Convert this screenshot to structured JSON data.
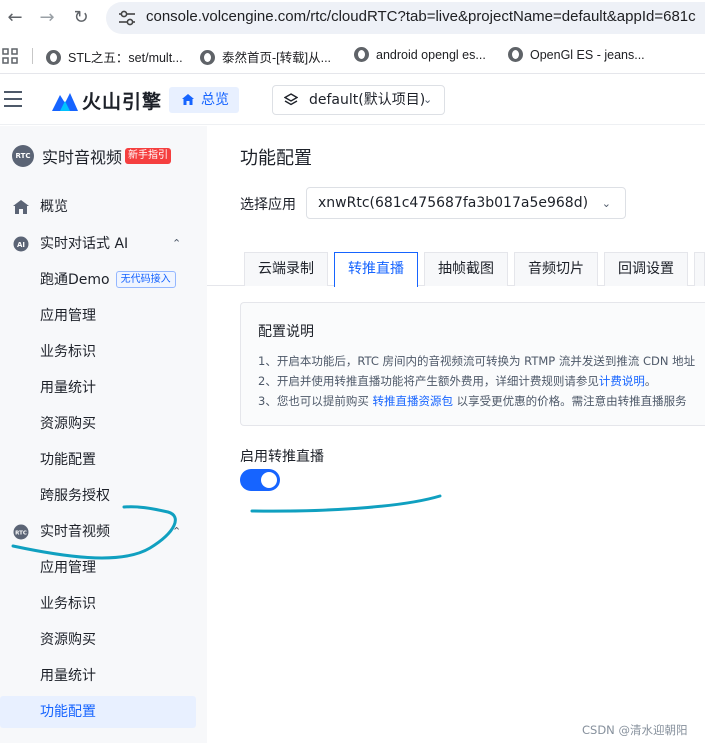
{
  "browser": {
    "url": "console.volcengine.com/rtc/cloudRTC?tab=live&projectName=default&appId=681c",
    "bookmarks": [
      {
        "label": "STL之五：set/mult..."
      },
      {
        "label": "泰然首页-[转载]从..."
      },
      {
        "label": "android opengl es..."
      },
      {
        "label": "OpenGl ES - jeans..."
      }
    ]
  },
  "header": {
    "logo_text": "火山引擎",
    "overview_label": "总览",
    "project_label": "default(默认项目)"
  },
  "sidebar": {
    "badge_text": "RTC",
    "title": "实时音视频",
    "new_tag": "新手指引",
    "items": [
      {
        "label": "概览",
        "icon": "house-icon"
      },
      {
        "label": "实时对话式 AI",
        "icon": "ai-icon",
        "chevron": "expanded"
      },
      {
        "label": "跑通Demo",
        "tag": "无代码接入"
      },
      {
        "label": "应用管理"
      },
      {
        "label": "业务标识"
      },
      {
        "label": "用量统计"
      },
      {
        "label": "资源购买"
      },
      {
        "label": "功能配置"
      },
      {
        "label": "跨服务授权"
      },
      {
        "label": "实时音视频",
        "icon": "rtc-icon",
        "chevron": "expanded"
      },
      {
        "label": "应用管理"
      },
      {
        "label": "业务标识"
      },
      {
        "label": "资源购买"
      },
      {
        "label": "用量统计"
      },
      {
        "label": "功能配置",
        "active": true
      }
    ]
  },
  "main": {
    "title": "功能配置",
    "app_label": "选择应用",
    "app_value": "xnwRtc(681c475687fa3b017a5e968d)",
    "tabs": [
      {
        "label": "云端录制"
      },
      {
        "label": "转推直播",
        "active": true
      },
      {
        "label": "抽帧截图"
      },
      {
        "label": "音频切片"
      },
      {
        "label": "回调设置"
      }
    ],
    "info": {
      "title": "配置说明",
      "line1": "1、开启本功能后，RTC 房间内的音视频流可转换为 RTMP 流并发送到推流 CDN 地址",
      "line2_pre": "2、开启并使用转推直播功能将产生额外费用，详细计费规则请参见",
      "line2_link": "计费说明",
      "line2_post": "。",
      "line3_pre": "3、您也可以提前购买 ",
      "line3_link": "转推直播资源包",
      "line3_post": " 以享受更优惠的价格。需注意由转推直播服务"
    },
    "toggle_label": "启用转推直播",
    "toggle_on": true
  },
  "watermark": "CSDN @清水迎朝阳",
  "colors": {
    "accent": "#1664ff",
    "annotation": "#10a0c0",
    "sidebar_bg": "#f7f8fa"
  }
}
